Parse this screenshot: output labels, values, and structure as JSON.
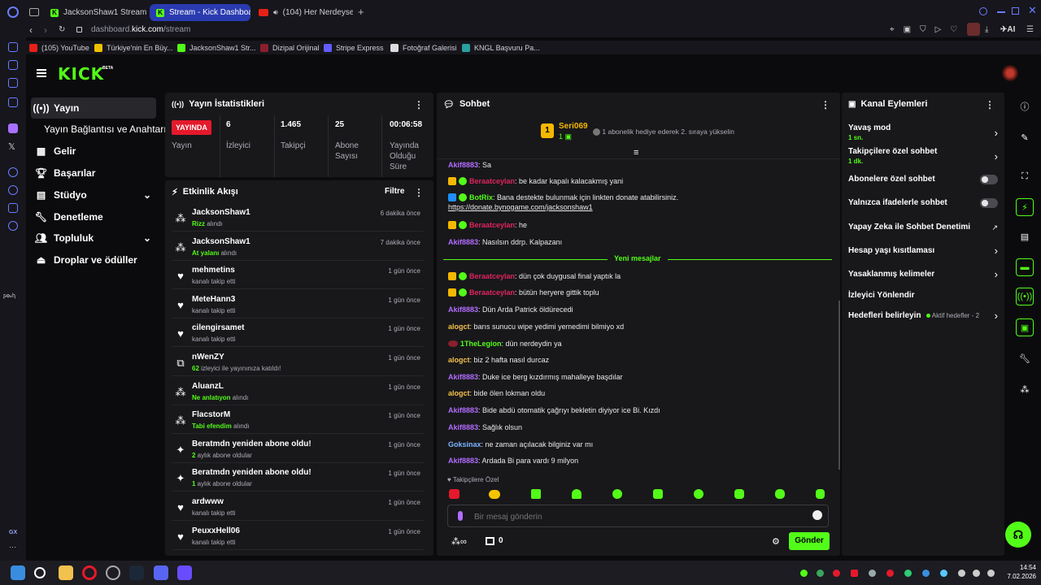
{
  "browser": {
    "tabs": [
      {
        "label": "JacksonShaw1 Stream - W",
        "icon": "kick"
      },
      {
        "label": "Stream - Kick Dashboard",
        "icon": "kick"
      },
      {
        "label": "(104) Her Nerdeysen -",
        "icon": "youtube"
      }
    ],
    "address_domain": "dashboard.",
    "address_host": "kick.com",
    "address_path": "/stream",
    "ai_label": "AI",
    "bookmarks": [
      "(105) YouTube",
      "Türkiye'nin En Büy...",
      "JacksonShaw1 Str...",
      "Dizipal Orijinal",
      "Stripe Express",
      "Fotoğraf Galerisi",
      "KNGL Başvuru Pa..."
    ]
  },
  "header": {
    "logo": "KICK",
    "logo_tag": "BETA"
  },
  "sidebar": {
    "items": [
      {
        "label": "Yayın",
        "icon": "stream-icon",
        "active": true
      },
      {
        "label": "Yayın Bağlantısı ve Anahtarı",
        "icon": ""
      },
      {
        "label": "Gelir",
        "icon": "revenue-icon"
      },
      {
        "label": "Başarılar",
        "icon": "trophy-icon"
      },
      {
        "label": "Stüdyo",
        "icon": "studio-icon"
      },
      {
        "label": "Denetleme",
        "icon": "wrench-icon"
      },
      {
        "label": "Topluluk",
        "icon": "community-icon"
      },
      {
        "label": "Droplar ve ödüller",
        "icon": "drops-icon"
      }
    ],
    "bottom_label": "GX"
  },
  "stats": {
    "title": "Yayın İstatistikleri",
    "live_badge": "YAYINDA",
    "live_label": "Yayın",
    "items": [
      {
        "value": "6",
        "label": "İzleyici"
      },
      {
        "value": "1.465",
        "label": "Takipçi"
      },
      {
        "value": "25",
        "label": "Abone Sayısı"
      },
      {
        "value": "00:06:58",
        "label": "Yayında Olduğu Süre"
      }
    ]
  },
  "activity": {
    "title": "Etkinlik Akışı",
    "filter_label": "Filtre",
    "items": [
      {
        "title": "JacksonShaw1",
        "highlight": "Rizz",
        "sub": " alındı",
        "time": "6 dakika önce",
        "icon": "reward-icon"
      },
      {
        "title": "JacksonShaw1",
        "highlight": "At yalanı",
        "sub": " alındı",
        "time": "7 dakika önce",
        "icon": "reward-icon"
      },
      {
        "title": "mehmetins",
        "highlight": "",
        "sub": "kanalı takip etti",
        "time": "1 gün önce",
        "icon": "heart-icon"
      },
      {
        "title": "MeteHann3",
        "highlight": "",
        "sub": "kanalı takip etti",
        "time": "1 gün önce",
        "icon": "heart-icon"
      },
      {
        "title": "cilengirsamet",
        "highlight": "",
        "sub": "kanalı takip etti",
        "time": "1 gün önce",
        "icon": "heart-icon"
      },
      {
        "title": "nWenZY",
        "highlight": "62",
        "sub": " izleyici ile yayınınıza katıldı!",
        "time": "1 gün önce",
        "icon": "host-icon"
      },
      {
        "title": "AluanzL",
        "highlight": "Ne anlatıyon",
        "sub": " alındı",
        "time": "1 gün önce",
        "icon": "reward-icon"
      },
      {
        "title": "FlacstorM",
        "highlight": "Tabi efendim",
        "sub": " alındı",
        "time": "1 gün önce",
        "icon": "reward-icon"
      },
      {
        "title": "Beratmdn yeniden abone oldu!",
        "highlight": "2",
        "sub": " aylık abone oldular",
        "time": "1 gün önce",
        "icon": "sparkle-icon"
      },
      {
        "title": "Beratmdn yeniden abone oldu!",
        "highlight": "1",
        "sub": " aylık abone oldular",
        "time": "1 gün önce",
        "icon": "sparkle-icon"
      },
      {
        "title": "ardwww",
        "highlight": "",
        "sub": "kanalı takip etti",
        "time": "1 gün önce",
        "icon": "heart-icon"
      },
      {
        "title": "PeuxxHell06",
        "highlight": "",
        "sub": "kanalı takip etti",
        "time": "1 gün önce",
        "icon": "heart-icon"
      }
    ]
  },
  "chat": {
    "title": "Sohbet",
    "gifter": {
      "name": "Seri069",
      "count": "1",
      "rank": "1",
      "promo": "1 abonelik hediye ederek 2. sıraya yükselin"
    },
    "new_messages_label": "Yeni mesajlar",
    "messages": [
      {
        "user": "Akif8883",
        "color": "#b26dff",
        "badges": [],
        "text": ": Sa"
      },
      {
        "user": "Beraatceylan",
        "color": "#e0245e",
        "badges": [
          "crown",
          "verified"
        ],
        "text": ": be kadar kapalı kalacakmış yani"
      },
      {
        "user": "BotRix",
        "color": "#53fc18",
        "badges": [
          "bot",
          "verified"
        ],
        "text": ": Bana destekte bulunmak için linkten donate atabilirsiniz.",
        "link": "https://donate.bynogame.com/jacksonshaw1"
      },
      {
        "user": "Beraatceylan",
        "color": "#e0245e",
        "badges": [
          "crown",
          "verified"
        ],
        "text": ": he"
      },
      {
        "user": "Akif8883",
        "color": "#b26dff",
        "badges": [],
        "text": ": Nasılsın ddrp. Kalpazanı"
      },
      {
        "user": "Beraatceylan",
        "color": "#e0245e",
        "badges": [
          "crown",
          "verified"
        ],
        "text": ": dün çok duygusal final yaptık la"
      },
      {
        "user": "Beraatceylan",
        "color": "#e0245e",
        "badges": [
          "crown",
          "verified"
        ],
        "text": ": bütün heryere gittik toplu"
      },
      {
        "user": "Akif8883",
        "color": "#b26dff",
        "badges": [],
        "text": ": Dün Arda Patrick öldürecedi"
      },
      {
        "user": "alogct",
        "color": "#f5c04a",
        "badges": [],
        "text": ": barıs sunucu wipe yedimi yemedimi bilmiyo xd"
      },
      {
        "user": "1TheLegion",
        "color": "#53fc18",
        "badges": [
          "legion"
        ],
        "text": ": dün nerdeydin ya"
      },
      {
        "user": "alogct",
        "color": "#f5c04a",
        "badges": [],
        "text": ": biz 2 hafta nasıl durcaz"
      },
      {
        "user": "Akif8883",
        "color": "#b26dff",
        "badges": [],
        "text": ": Duke ice berg kızdırmış mahalleye başdılar"
      },
      {
        "user": "alogct",
        "color": "#f5c04a",
        "badges": [],
        "text": ": bide ölen lokman oldu"
      },
      {
        "user": "Akif8883",
        "color": "#b26dff",
        "badges": [],
        "text": ": Bide abdü otomatik çağrıyı bekletin diyiyor ice Bi. Kızdı"
      },
      {
        "user": "Akif8883",
        "color": "#b26dff",
        "badges": [],
        "text": ": Sağlık olsun"
      },
      {
        "user": "Goksinax",
        "color": "#7ab4ff",
        "badges": [],
        "text": ": ne zaman açılacak bilginiz var mı"
      },
      {
        "user": "Akif8883",
        "color": "#b26dff",
        "badges": [],
        "text": ": Ardada Bi para vardı 9 milyon"
      }
    ],
    "followers_only_label": "Takipçilere Özel",
    "input_placeholder": "Bir mesaj gönderin",
    "points": "0",
    "send_label": "Gönder"
  },
  "channel_actions": {
    "title": "Kanal Eylemleri",
    "items": [
      {
        "label": "Yavaş mod",
        "sub": "1 sn.",
        "control": "arrow"
      },
      {
        "label": "Takipçilere özel sohbet",
        "sub": "1 dk.",
        "control": "arrow"
      },
      {
        "label": "Abonelere özel sohbet",
        "sub": "",
        "control": "toggle"
      },
      {
        "label": "Yalnızca ifadelerle sohbet",
        "sub": "",
        "control": "toggle"
      },
      {
        "label": "Yapay Zeka ile Sohbet Denetimi",
        "sub": "",
        "control": "external"
      },
      {
        "label": "Hesap yaşı kısıtlaması",
        "sub": "",
        "control": "arrow"
      },
      {
        "label": "Yasaklanmış kelimeler",
        "sub": "",
        "control": "arrow"
      },
      {
        "label": "İzleyici Yönlendir",
        "sub": "",
        "control": "none"
      },
      {
        "label": "Hedefleri belirleyin",
        "sub": "",
        "control": "arrow",
        "extra": "Aktif hedefler - 2"
      }
    ]
  },
  "taskbar": {
    "time": "14:54",
    "date": "7.02.2026"
  },
  "colors": {
    "accent": "#53fc18",
    "live": "#e5192b",
    "panel": "#18181b",
    "bg": "#0b0b0d"
  }
}
